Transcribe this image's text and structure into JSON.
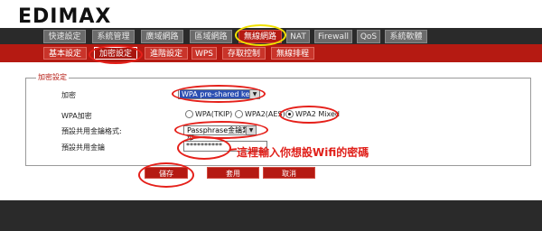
{
  "brand": {
    "logo_text": "EDIMAX"
  },
  "tabs": {
    "t1": "快速設定",
    "t2": "系統管理",
    "t3": "廣域網路",
    "t4": "區域網路",
    "t5": "無線網路",
    "t6": "NAT",
    "t7": "Firewall",
    "t8": "QoS",
    "t9": "系統軟體"
  },
  "subtabs": {
    "s1": "基本設定",
    "s2": "加密設定",
    "s3": "進階設定",
    "s4": "WPS",
    "s5": "存取控制",
    "s6": "無線排程"
  },
  "encryption": {
    "section_title": "加密設定",
    "encryption_label": "加密",
    "encryption_value": "WPA pre-shared key",
    "wpa_label": "WPA加密",
    "radio_tkip": "WPA(TKIP)",
    "radio_aes": "WPA2(AES)",
    "radio_mixed": "WPA2 Mixed",
    "psk_format_label": "預設共用金鑰格式:",
    "psk_format_value": "Passphrase金鑰類型",
    "psk_label": "預設共用金鑰",
    "psk_value": "**********"
  },
  "buttons": {
    "save": "儲存",
    "apply": "套用",
    "cancel": "取消"
  },
  "annotation": {
    "note": "這裡輸入你想設Wifi的密碼"
  },
  "colors": {
    "brand_red": "#b51a12",
    "annotation_red": "#e5201a",
    "highlight_yellow": "#f2e200"
  }
}
